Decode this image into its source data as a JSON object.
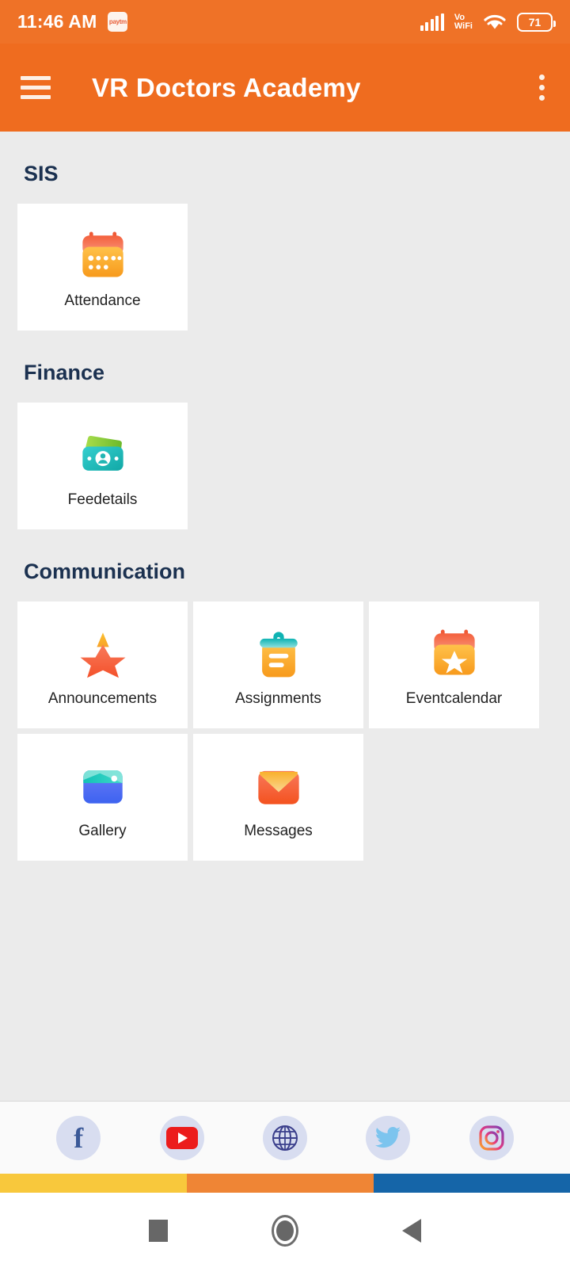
{
  "status_bar": {
    "time": "11:46 AM",
    "notification_icon_label": "paytm",
    "network_label": "Vo",
    "network_label2": "WiFi",
    "battery_percent": "71"
  },
  "app_bar": {
    "title": "VR Doctors Academy",
    "menu_icon": "hamburger-menu-icon",
    "overflow_icon": "more-vert-icon"
  },
  "sections": [
    {
      "title": "SIS",
      "items": [
        {
          "label": "Attendance",
          "icon": "calendar-icon"
        }
      ]
    },
    {
      "title": "Finance",
      "items": [
        {
          "label": "Feedetails",
          "icon": "money-icon"
        }
      ]
    },
    {
      "title": "Communication",
      "items": [
        {
          "label": "Announcements",
          "icon": "star-icon"
        },
        {
          "label": "Assignments",
          "icon": "clipboard-icon"
        },
        {
          "label": "Eventcalendar",
          "icon": "calendar-star-icon"
        },
        {
          "label": "Gallery",
          "icon": "image-icon"
        },
        {
          "label": "Messages",
          "icon": "envelope-icon"
        }
      ]
    }
  ],
  "social": [
    {
      "name": "facebook",
      "label": "f"
    },
    {
      "name": "youtube",
      "label": ""
    },
    {
      "name": "website",
      "label": ""
    },
    {
      "name": "twitter",
      "label": ""
    },
    {
      "name": "instagram",
      "label": ""
    }
  ],
  "colors": {
    "app_bar": "#ef6c1f",
    "status_bar": "#ef7227",
    "background": "#ebebeb",
    "section_title": "#1b3150",
    "stripe_yellow": "#f8c83c",
    "stripe_orange": "#ef8535",
    "stripe_blue": "#1565a8"
  },
  "nav_bar": {
    "recents": "square-icon",
    "home": "circle-icon",
    "back": "triangle-back-icon"
  }
}
